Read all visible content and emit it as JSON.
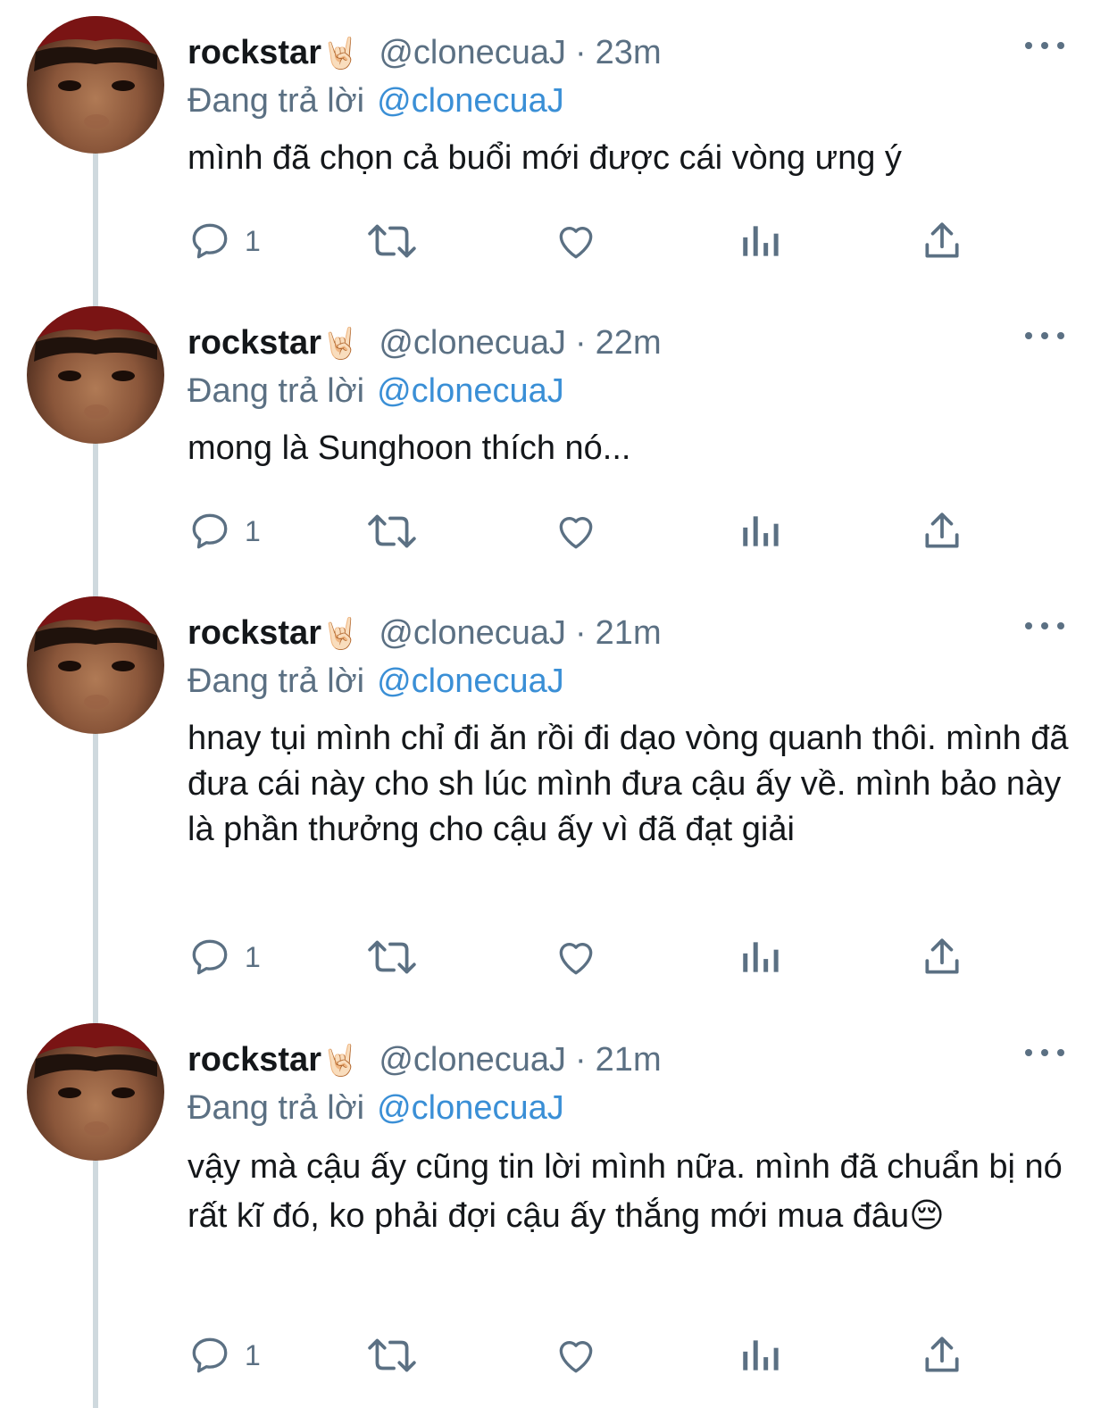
{
  "colors": {
    "text": "#14171a",
    "muted": "#5b7083",
    "link": "#3a8fd6",
    "thread_line": "#cfd9de"
  },
  "icons": {
    "reply": "speech-bubble-icon",
    "retweet": "retweet-icon",
    "like": "heart-icon",
    "views": "bar-chart-icon",
    "share": "share-icon",
    "more": "more-dots-icon",
    "name_emoji": "🤘🏻"
  },
  "tweets": [
    {
      "display_name": "rockstar",
      "name_emoji": "🤘🏻",
      "handle": "@clonecuaJ",
      "separator": "·",
      "time": "23m",
      "reply_label": "Đang trả lời",
      "reply_to": "@clonecuaJ",
      "text": "mình đã chọn cả buổi mới được cái vòng ưng ý",
      "reply_count": "1"
    },
    {
      "display_name": "rockstar",
      "name_emoji": "🤘🏻",
      "handle": "@clonecuaJ",
      "separator": "·",
      "time": "22m",
      "reply_label": "Đang trả lời",
      "reply_to": "@clonecuaJ",
      "text": "mong là Sunghoon thích nó...",
      "reply_count": "1"
    },
    {
      "display_name": "rockstar",
      "name_emoji": "🤘🏻",
      "handle": "@clonecuaJ",
      "separator": "·",
      "time": "21m",
      "reply_label": "Đang trả lời",
      "reply_to": "@clonecuaJ",
      "text": "hnay tụi mình chỉ đi ăn rồi đi dạo vòng quanh thôi. mình đã đưa cái này cho sh lúc mình đưa cậu ấy về. mình bảo này là phần thưởng cho cậu ấy vì đã đạt giải",
      "reply_count": "1"
    },
    {
      "display_name": "rockstar",
      "name_emoji": "🤘🏻",
      "handle": "@clonecuaJ",
      "separator": "·",
      "time": "21m",
      "reply_label": "Đang trả lời",
      "reply_to": "@clonecuaJ",
      "text": "vậy mà cậu ấy cũng tin lời mình nữa. mình đã chuẩn bị nó rất kĩ đó, ko phải đợi cậu ấy thắng mới mua đâu😔",
      "reply_count": "1"
    }
  ]
}
